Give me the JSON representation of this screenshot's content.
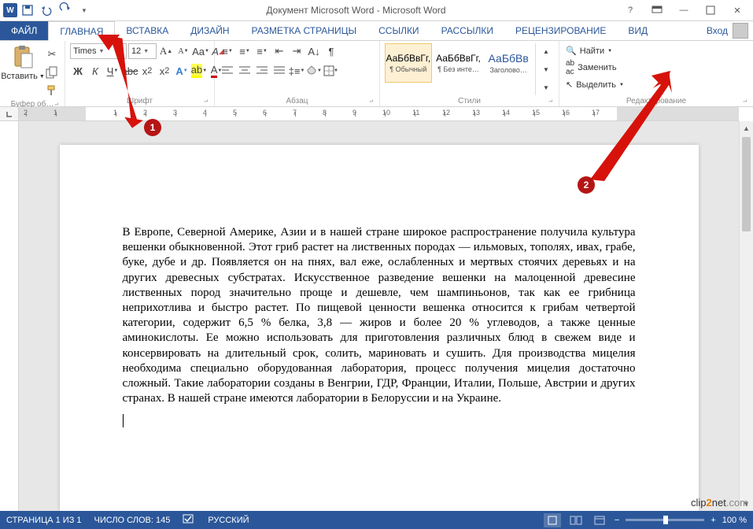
{
  "title": "Документ Microsoft Word - Microsoft Word",
  "tabs": {
    "file": "ФАЙЛ",
    "home": "ГЛАВНАЯ",
    "insert": "ВСТАВКА",
    "design": "ДИЗАЙН",
    "layout": "РАЗМЕТКА СТРАНИЦЫ",
    "references": "ССЫЛКИ",
    "mailings": "РАССЫЛКИ",
    "review": "РЕЦЕНЗИРОВАНИЕ",
    "view": "ВИД"
  },
  "login": "Вход",
  "ribbon": {
    "clipboard": {
      "paste": "Вставить",
      "label": "Буфер об…"
    },
    "font": {
      "name": "Times",
      "size": "12",
      "label": "Шрифт"
    },
    "paragraph": {
      "label": "Абзац"
    },
    "styles": {
      "label": "Стили",
      "items": [
        {
          "sample": "АаБбВвГг,",
          "name": "¶ Обычный"
        },
        {
          "sample": "АаБбВвГг,",
          "name": "¶ Без инте…"
        },
        {
          "sample": "АаБбВв",
          "name": "Заголово…"
        }
      ]
    },
    "editing": {
      "find": "Найти",
      "replace": "Заменить",
      "select": "Выделить",
      "label": "Редактирование"
    }
  },
  "document": {
    "text": "В Европе, Северной Америке, Азии и в нашей стране широкое распространение получила культура вешенки обыкновенной. Этот гриб растет на лиственных породах — ильмовых, тополях, ивах, грабе, буке, дубе и др. Появляется он на пнях, вал еже, ослабленных и мертвых стоячих деревьях и на других древесных субстратах. Искусственное разведение вешенки на малоценной древесине лиственных пород значительно проще и дешевле, чем шампиньонов, так как ее грибница неприхотлива и быстро растет. По пищевой ценности вешенка относится к грибам четвертой категории, содержит 6,5 % белка, 3,8 — жиров и более 20 % углеводов, а также ценные аминокислоты. Ее можно использовать для приготовления различных блюд в свежем виде и консервировать на длительный срок, солить, мариновать и сушить. Для производства мицелия необходима специально оборудованная лаборатория, процесс получения мицелия достаточно сложный. Такие лаборатории созданы в Венгрии, ГДР, Франции, Италии, Польше, Австрии и других странах. В нашей стране имеются лаборатории в Белоруссии и на Украине."
  },
  "ruler": {
    "numbers": [
      "2",
      "1",
      "1",
      "2",
      "3",
      "4",
      "5",
      "6",
      "7",
      "8",
      "9",
      "10",
      "11",
      "12",
      "13",
      "14",
      "15",
      "16",
      "17"
    ]
  },
  "status": {
    "page": "СТРАНИЦА 1 ИЗ 1",
    "words": "ЧИСЛО СЛОВ: 145",
    "lang": "РУССКИЙ",
    "zoom": "100 %"
  },
  "callouts": {
    "c1": "1",
    "c2": "2"
  },
  "watermark": {
    "p1": "clip",
    "p2": "2",
    "p3": "net",
    "p4": ".com"
  }
}
